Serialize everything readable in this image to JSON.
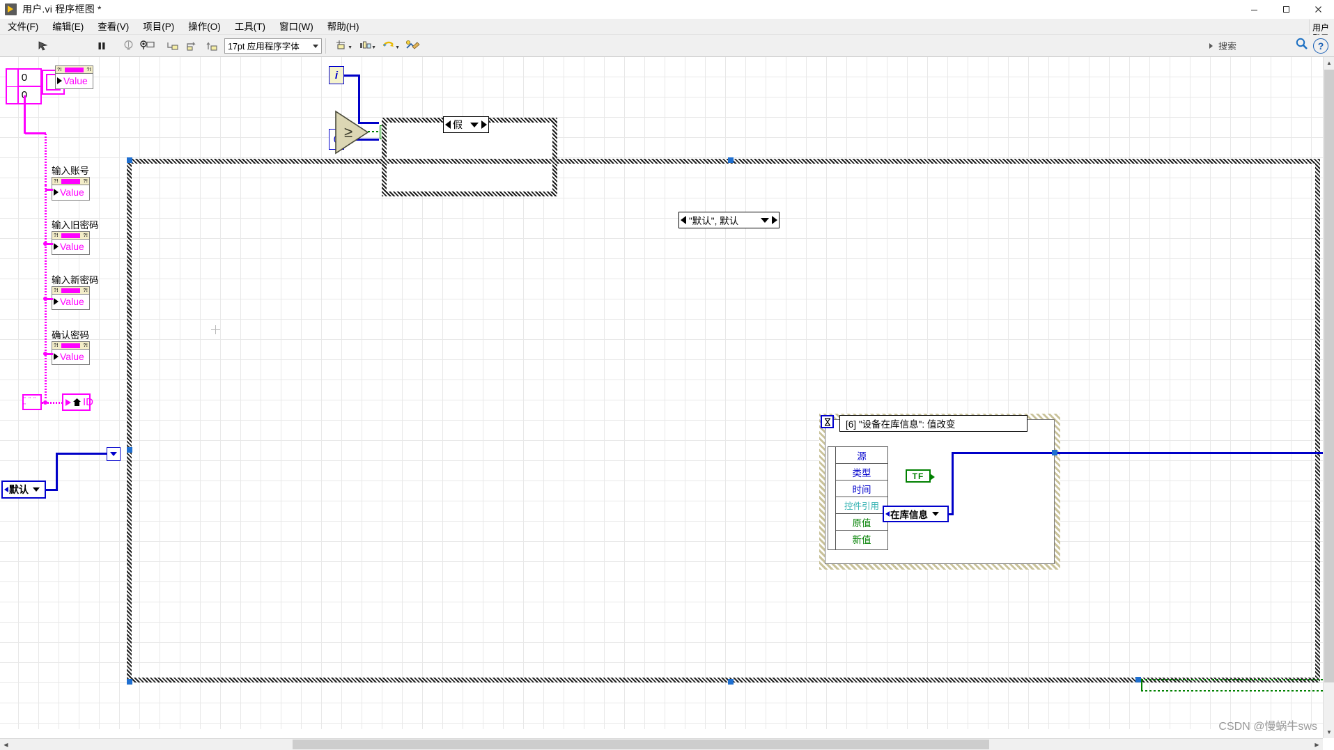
{
  "window": {
    "title": "用户.vi 程序框图 *",
    "app_icon": "labview-run-icon",
    "minimize": "minimize-icon",
    "maximize": "maximize-icon",
    "close": "close-icon"
  },
  "menubar": {
    "items": [
      {
        "label": "文件(F)",
        "name": "menu-file"
      },
      {
        "label": "编辑(E)",
        "name": "menu-edit"
      },
      {
        "label": "查看(V)",
        "name": "menu-view"
      },
      {
        "label": "项目(P)",
        "name": "menu-project"
      },
      {
        "label": "操作(O)",
        "name": "menu-operate"
      },
      {
        "label": "工具(T)",
        "name": "menu-tools"
      },
      {
        "label": "窗口(W)",
        "name": "menu-window"
      },
      {
        "label": "帮助(H)",
        "name": "menu-help"
      }
    ]
  },
  "user_panel": {
    "line1": "用户",
    "line2": "登录"
  },
  "toolbar": {
    "buttons": [
      {
        "name": "run-button",
        "icon": "run-arrow-icon"
      },
      {
        "name": "run-continuously-button",
        "icon": "run-continuous-icon"
      },
      {
        "name": "abort-button",
        "icon": "abort-stop-icon"
      },
      {
        "name": "pause-button",
        "icon": "pause-icon"
      },
      {
        "name": "highlight-execution-button",
        "icon": "lightbulb-icon"
      },
      {
        "name": "retain-wire-values-button",
        "icon": "retain-values-icon"
      },
      {
        "name": "step-into-button",
        "icon": "step-into-icon"
      },
      {
        "name": "step-over-button",
        "icon": "step-over-icon"
      },
      {
        "name": "step-out-button",
        "icon": "step-out-icon"
      }
    ],
    "font_selector": {
      "value": "17pt 应用程序字体",
      "name": "font-selector"
    },
    "align_button": {
      "name": "align-objects-button",
      "icon": "align-icon"
    },
    "distribute_button": {
      "name": "distribute-objects-button",
      "icon": "distribute-icon"
    },
    "reorder_button": {
      "name": "reorder-objects-button",
      "icon": "reorder-icon"
    },
    "cleanup_button": {
      "name": "cleanup-diagram-button",
      "icon": "cleanup-icon"
    },
    "search": {
      "placeholder": "搜索",
      "value": "搜索",
      "icon": "search-icon"
    },
    "help": {
      "label": "?",
      "name": "context-help-button"
    }
  },
  "diagram": {
    "array_constant": {
      "values": [
        "0",
        "0"
      ],
      "name": "array-constant"
    },
    "property_nodes": [
      {
        "label": "",
        "property": "Value",
        "name": "property-node-value-0"
      },
      {
        "label": "输入账号",
        "property": "Value",
        "name": "property-node-input-account"
      },
      {
        "label": "输入旧密码",
        "property": "Value",
        "name": "property-node-input-old-password"
      },
      {
        "label": "输入新密码",
        "property": "Value",
        "name": "property-node-input-new-password"
      },
      {
        "label": "确认密码",
        "property": "Value",
        "name": "property-node-confirm-password"
      }
    ],
    "id_node": {
      "property": "ID",
      "icon": "home-icon",
      "name": "property-node-id"
    },
    "ref_constant": {
      "text": "\" \" \" \"",
      "name": "reference-constant"
    },
    "loop_iterator": {
      "label": "i",
      "name": "loop-iteration-terminal"
    },
    "zero_constant": {
      "value": "0",
      "name": "numeric-constant-zero"
    },
    "comparison": {
      "symbol": "≥",
      "name": "greater-or-equal-function"
    },
    "case_structure_top": {
      "selector_label": "假",
      "name": "case-structure-false"
    },
    "case_structure_main": {
      "selector_label": "\"默认\", 默认",
      "name": "case-structure-default"
    },
    "enum_constant": {
      "value": "默认",
      "name": "enum-constant-default"
    },
    "event_structure": {
      "selector_label": "[6] \"设备在库信息\": 值改变",
      "icon": "hourglass-icon",
      "name": "event-structure",
      "data_node": {
        "rows": [
          {
            "label": "源",
            "color": "#0000cc"
          },
          {
            "label": "类型",
            "color": "#0000cc"
          },
          {
            "label": "时间",
            "color": "#0000cc"
          },
          {
            "label": "控件引用",
            "color": "#33b2b2"
          },
          {
            "label": "原值",
            "color": "#008000"
          },
          {
            "label": "新值",
            "color": "#008000"
          }
        ],
        "name": "event-data-node"
      }
    },
    "boolean_constant": {
      "value": "TF",
      "name": "boolean-constant-tf"
    },
    "ring_constant": {
      "value": "在库信息",
      "name": "ring-constant-inventory-info"
    }
  },
  "watermark": {
    "text": "CSDN @慢蜗牛sws"
  },
  "colors": {
    "magenta_wire": "#ff00ff",
    "blue_wire": "#0000c8",
    "green_wire": "#008000",
    "selection": "#1f6fd0",
    "property_header": "#f3edc8"
  }
}
